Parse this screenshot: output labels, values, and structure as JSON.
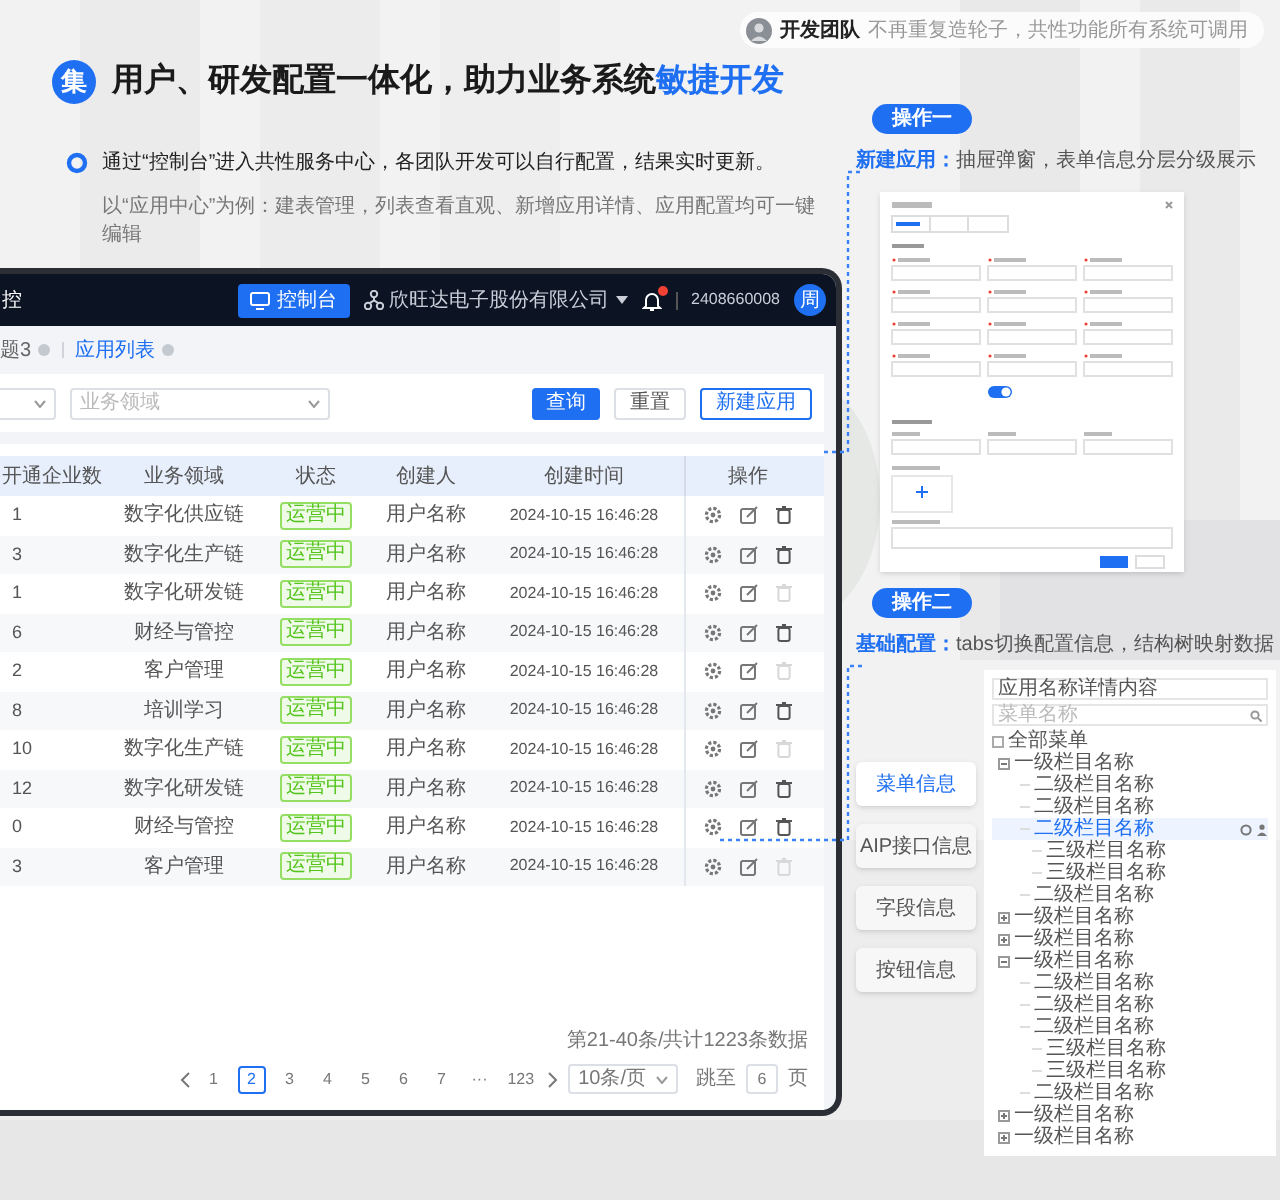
{
  "badge": "集",
  "headline": [
    {
      "text": "用户、研发配置一体化，助力业务系统",
      "emphasis": false
    },
    {
      "text": "敏捷开发",
      "emphasis": true
    }
  ],
  "team_note": {
    "name": "开发团队",
    "text": "不再重复造轮子，共性功能所有系统可调用"
  },
  "intro": "通过“控制台”进入共性服务中心，各团队开发可以自行配置，结果实时更新。",
  "example": "以“应用中心”为例：建表管理，列表查看直观、新增应用详情、应用配置均可一键编辑",
  "app_window": {
    "title": "控",
    "console_button": "控制台",
    "company": "欣旺达电子股份有限公司",
    "account": "2408660008",
    "avatar": "周",
    "tabs": [
      {
        "label": "题3",
        "selected": false
      },
      {
        "label": "应用列表",
        "selected": true
      }
    ],
    "filter": {
      "placeholder": "业务领域"
    },
    "buttons": [
      {
        "label": "查询",
        "kind": "primary"
      },
      {
        "label": "重置",
        "kind": "default"
      },
      {
        "label": "新建应用",
        "kind": "outline"
      }
    ],
    "columns": [
      "开通企业数",
      "业务领域",
      "状态",
      "创建人",
      "创建时间",
      "操作"
    ],
    "rows": [
      {
        "count": "1",
        "domain": "数字化供应链",
        "status": "运营中",
        "creator": "用户名称",
        "created": "2024-10-15 16:46:28",
        "delete_enabled": true
      },
      {
        "count": "3",
        "domain": "数字化生产链",
        "status": "运营中",
        "creator": "用户名称",
        "created": "2024-10-15 16:46:28",
        "delete_enabled": true
      },
      {
        "count": "1",
        "domain": "数字化研发链",
        "status": "运营中",
        "creator": "用户名称",
        "created": "2024-10-15 16:46:28",
        "delete_enabled": false
      },
      {
        "count": "6",
        "domain": "财经与管控",
        "status": "运营中",
        "creator": "用户名称",
        "created": "2024-10-15 16:46:28",
        "delete_enabled": true
      },
      {
        "count": "2",
        "domain": "客户管理",
        "status": "运营中",
        "creator": "用户名称",
        "created": "2024-10-15 16:46:28",
        "delete_enabled": false
      },
      {
        "count": "8",
        "domain": "培训学习",
        "status": "运营中",
        "creator": "用户名称",
        "created": "2024-10-15 16:46:28",
        "delete_enabled": true
      },
      {
        "count": "10",
        "domain": "数字化生产链",
        "status": "运营中",
        "creator": "用户名称",
        "created": "2024-10-15 16:46:28",
        "delete_enabled": false
      },
      {
        "count": "12",
        "domain": "数字化研发链",
        "status": "运营中",
        "creator": "用户名称",
        "created": "2024-10-15 16:46:28",
        "delete_enabled": true
      },
      {
        "count": "0",
        "domain": "财经与管控",
        "status": "运营中",
        "creator": "用户名称",
        "created": "2024-10-15 16:46:28",
        "delete_enabled": true
      },
      {
        "count": "3",
        "domain": "客户管理",
        "status": "运营中",
        "creator": "用户名称",
        "created": "2024-10-15 16:46:28",
        "delete_enabled": false
      }
    ],
    "pagination": {
      "summary": "第21-40条/共计1223条数据",
      "pages": [
        {
          "label": "1",
          "selected": false
        },
        {
          "label": "2",
          "selected": true
        },
        {
          "label": "3",
          "selected": false
        },
        {
          "label": "4",
          "selected": false
        },
        {
          "label": "5",
          "selected": false
        },
        {
          "label": "6",
          "selected": false
        },
        {
          "label": "7",
          "selected": false
        },
        {
          "label": "···",
          "selected": false
        },
        {
          "label": "123",
          "selected": false
        }
      ],
      "page_size": "10条/页",
      "jump_label": "跳至",
      "jump_value": "6",
      "page_unit": "页"
    }
  },
  "operation_1": {
    "label": "操作一",
    "heading": "新建应用：",
    "text": "抽屉弹窗，表单信息分层分级展示"
  },
  "operation_2": {
    "label": "操作二",
    "heading": "基础配置：",
    "text": "tabs切换配置信息，结构树映射数据",
    "tabs": [
      {
        "label": "菜单信息",
        "selected": true
      },
      {
        "label": "AIP接口信息",
        "selected": false
      },
      {
        "label": "字段信息",
        "selected": false
      },
      {
        "label": "按钮信息",
        "selected": false
      }
    ],
    "tree": {
      "title": "应用名称详情内容",
      "search_placeholder": "菜单名称",
      "root": {
        "label": "全部菜单",
        "checked": false,
        "selected": false,
        "children": [
          {
            "label": "一级栏目名称",
            "expanded": true,
            "selected": false,
            "children": [
              {
                "label": "二级栏目名称",
                "selected": false
              },
              {
                "label": "二级栏目名称",
                "selected": false
              },
              {
                "label": "二级栏目名称",
                "selected": true,
                "children": [
                  {
                    "label": "三级栏目名称",
                    "selected": false
                  },
                  {
                    "label": "三级栏目名称",
                    "selected": false
                  }
                ]
              },
              {
                "label": "二级栏目名称",
                "selected": false
              }
            ]
          },
          {
            "label": "一级栏目名称",
            "expanded": false,
            "selected": false
          },
          {
            "label": "一级栏目名称",
            "expanded": false,
            "selected": false
          },
          {
            "label": "一级栏目名称",
            "expanded": true,
            "selected": false,
            "children": [
              {
                "label": "二级栏目名称",
                "selected": false
              },
              {
                "label": "二级栏目名称",
                "selected": false
              },
              {
                "label": "二级栏目名称",
                "selected": false,
                "children": [
                  {
                    "label": "三级栏目名称",
                    "selected": false
                  },
                  {
                    "label": "三级栏目名称",
                    "selected": false
                  }
                ]
              },
              {
                "label": "二级栏目名称",
                "selected": false
              }
            ]
          },
          {
            "label": "一级栏目名称",
            "expanded": false,
            "selected": false
          },
          {
            "label": "一级栏目名称",
            "expanded": false,
            "selected": false
          }
        ]
      }
    }
  }
}
